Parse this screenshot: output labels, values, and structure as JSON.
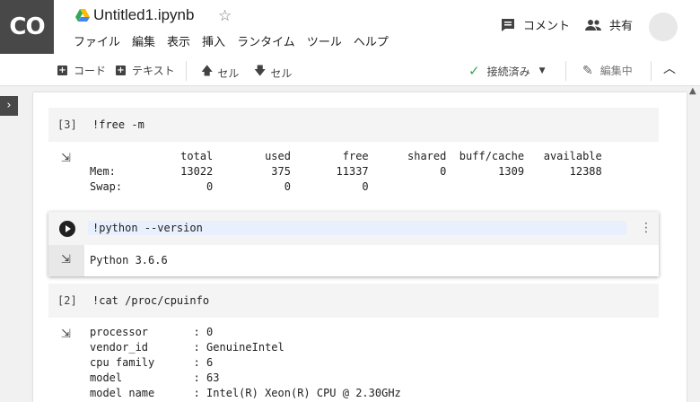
{
  "header": {
    "logo_text": "CO",
    "notebook_title": "Untitled1.ipynb",
    "star_icon": "☆",
    "menu": [
      "ファイル",
      "編集",
      "表示",
      "挿入",
      "ランタイム",
      "ツール",
      "ヘルプ"
    ],
    "comment_label": "コメント",
    "share_label": "共有"
  },
  "toolbar": {
    "add_code": "コード",
    "add_text": "テキスト",
    "cell_up": "セル",
    "cell_down": "セル",
    "connection_status": "接続済み",
    "edit_mode": "編集中"
  },
  "cells": [
    {
      "prompt": "[3]",
      "code": "!free -m",
      "output": "              total        used        free      shared  buff/cache   available\nMem:          13022         375       11337           0        1309       12388\nSwap:             0           0           0"
    },
    {
      "prompt": "",
      "code": "!python --version",
      "output": "Python 3.6.6"
    },
    {
      "prompt": "[2]",
      "code": "!cat /proc/cpuinfo",
      "output": "processor       : 0\nvendor_id       : GenuineIntel\ncpu family      : 6\nmodel           : 63\nmodel name      : Intel(R) Xeon(R) CPU @ 2.30GHz"
    }
  ]
}
